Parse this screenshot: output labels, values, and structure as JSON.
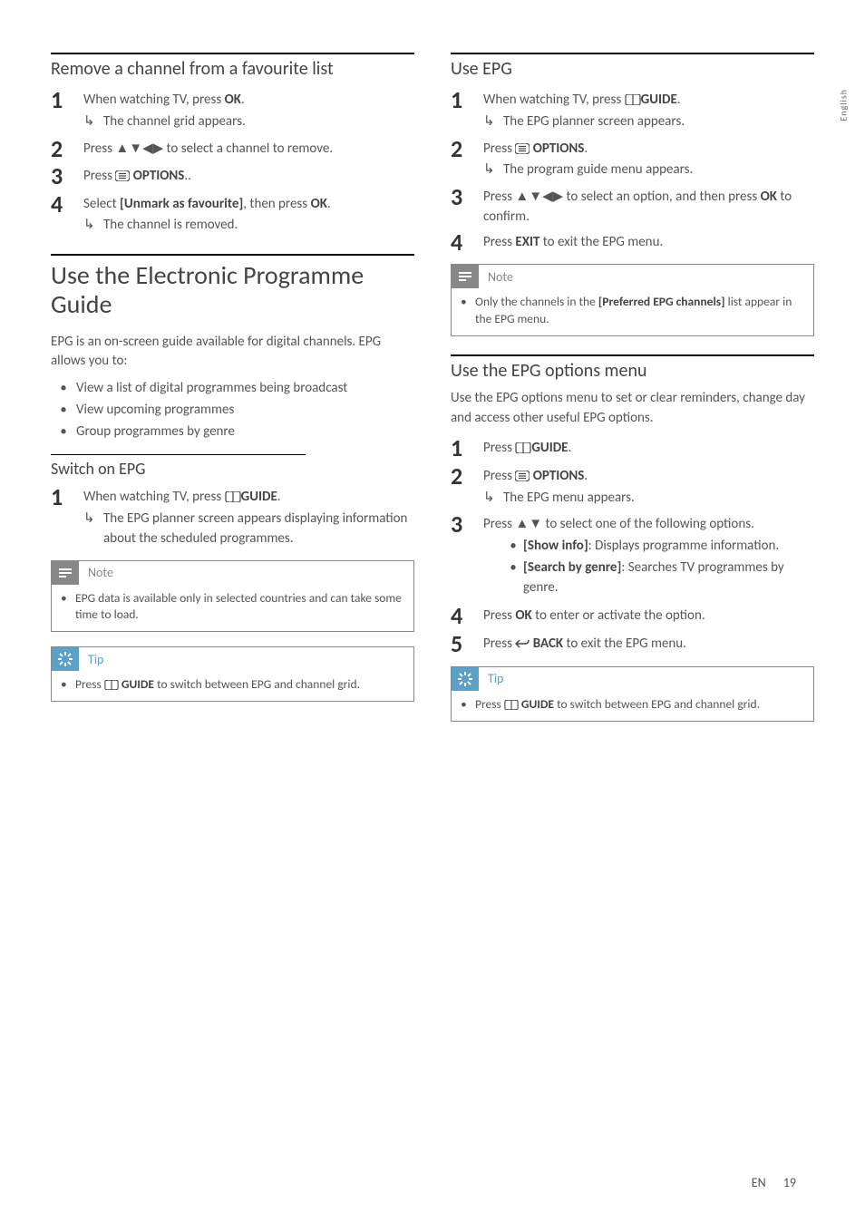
{
  "lang_tab": "English",
  "footer": {
    "lang": "EN",
    "page": "19"
  },
  "icons": {
    "arrows4": "▲▼◀▶",
    "arrows2": "▲▼",
    "sub_arrow": "↳",
    "note_label": "Note",
    "tip_label": "Tip"
  },
  "left": {
    "remove": {
      "title": "Remove a channel from a favourite list",
      "s1a": "When watching TV, press ",
      "s1b": "OK",
      "s1c": ".",
      "s1_sub": "The channel grid appears.",
      "s2a": "Press ",
      "s2b": " to select a channel to remove.",
      "s3a": "Press ",
      "s3b": " OPTIONS",
      "s3c": "..",
      "s4a": "Select ",
      "s4b": "[Unmark as favourite]",
      "s4c": ", then press ",
      "s4d": "OK",
      "s4e": ".",
      "s4_sub": "The channel is removed."
    },
    "epg_main": {
      "title": "Use the Electronic Programme Guide",
      "intro": "EPG is an on-screen guide available for digital channels. EPG allows you to:",
      "b1": "View a list of digital programmes being broadcast",
      "b2": "View upcoming programmes",
      "b3": "Group programmes by genre"
    },
    "switch": {
      "title": "Switch on EPG",
      "s1a": "When watching TV, press ",
      "s1b": "GUIDE",
      "s1c": ".",
      "s1_sub": "The EPG planner screen appears displaying information about the scheduled programmes.",
      "note": "EPG data is available only in selected countries and can take some time to load.",
      "tip_a": "Press ",
      "tip_b": " GUIDE",
      "tip_c": " to switch between EPG and channel grid."
    }
  },
  "right": {
    "use_epg": {
      "title": "Use EPG",
      "s1a": "When watching TV, press ",
      "s1b": "GUIDE",
      "s1c": ".",
      "s1_sub": "The EPG planner screen appears.",
      "s2a": "Press ",
      "s2b": " OPTIONS",
      "s2c": ".",
      "s2_sub": "The program guide menu appears.",
      "s3a": "Press ",
      "s3b": " to select an option, and then press ",
      "s3c": "OK",
      "s3d": " to confirm.",
      "s4a": "Press ",
      "s4b": "EXIT",
      "s4c": " to exit the EPG menu.",
      "note_a": "Only the channels in the ",
      "note_b": "[Preferred EPG channels]",
      "note_c": " list appear in the EPG menu."
    },
    "opt_menu": {
      "title": "Use the EPG options menu",
      "intro": "Use the EPG options menu to set or clear reminders, change day and access other useful EPG options.",
      "s1a": "Press ",
      "s1b": "GUIDE",
      "s1c": ".",
      "s2a": "Press ",
      "s2b": " OPTIONS",
      "s2c": ".",
      "s2_sub": "The EPG menu appears.",
      "s3a": "Press ",
      "s3b": " to select one of the following options.",
      "s3_o1a": "[Show info]",
      "s3_o1b": ": Displays programme information.",
      "s3_o2a": "[Search by genre]",
      "s3_o2b": ": Searches TV programmes by genre.",
      "s4a": "Press ",
      "s4b": "OK",
      "s4c": " to enter or activate the option.",
      "s5a": "Press ",
      "s5b": " BACK",
      "s5c": " to exit the EPG menu.",
      "tip_a": "Press ",
      "tip_b": " GUIDE",
      "tip_c": " to switch between EPG and channel grid."
    }
  }
}
